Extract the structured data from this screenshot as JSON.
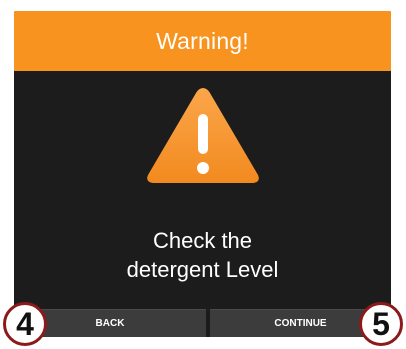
{
  "dialog": {
    "title": "Warning!",
    "message_line1": "Check the",
    "message_line2": "detergent Level"
  },
  "icon": {
    "name": "warning-triangle-icon",
    "color": "#f7931e"
  },
  "buttons": {
    "back_label": "BACK",
    "continue_label": "CONTINUE"
  },
  "callouts": {
    "back_number": "4",
    "continue_number": "5"
  },
  "colors": {
    "header": "#f7931e",
    "background": "#1c1c1c",
    "button": "#3c3c3c",
    "callout_border": "#8b1a1a"
  }
}
